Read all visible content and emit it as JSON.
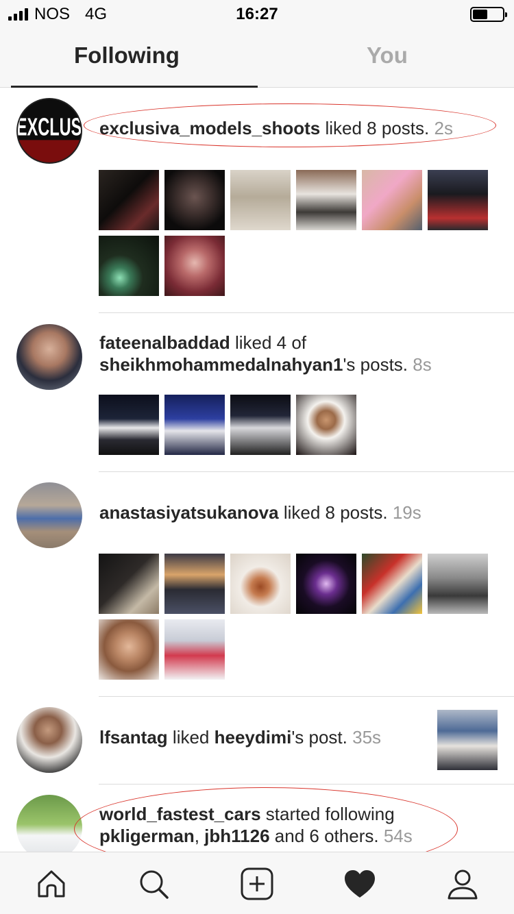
{
  "status_bar": {
    "carrier": "NOS",
    "network": "4G",
    "time": "16:27"
  },
  "tabs": [
    {
      "label": "Following",
      "active": true
    },
    {
      "label": "You",
      "active": false
    }
  ],
  "feed": [
    {
      "user": "exclusiva_models_shoots",
      "action": " liked 8 posts.",
      "time": "2s",
      "avatar_text": "EXCLUS",
      "photos": 8,
      "highlighted": true
    },
    {
      "user": "fateenalbaddad",
      "action": " liked 4 of",
      "target": "sheikhmohammedalnahyan1",
      "target_suffix": "'s posts.",
      "time": "8s",
      "photos": 4,
      "highlighted": false
    },
    {
      "user": "anastasiyatsukanova",
      "action": " liked 8 posts.",
      "time": "19s",
      "photos": 8,
      "highlighted": false
    },
    {
      "user": "lfsantag",
      "action": " liked ",
      "target": "heeydimi",
      "target_suffix": "'s post.",
      "time": "35s",
      "photos": 1,
      "highlighted": false
    },
    {
      "user": "world_fastest_cars",
      "action": " started following",
      "targets": [
        "pkligerman",
        "jbh1126"
      ],
      "target_suffix": " and 6 others.",
      "time": "54s",
      "highlighted": true
    }
  ],
  "bottom_nav": [
    {
      "icon": "home-icon"
    },
    {
      "icon": "search-icon"
    },
    {
      "icon": "add-post-icon"
    },
    {
      "icon": "heart-icon",
      "active": true
    },
    {
      "icon": "profile-icon"
    }
  ],
  "colors": {
    "highlight_ring": "#d9342b",
    "time_gray": "#999999",
    "inactive_tab": "#aaaaaa"
  }
}
